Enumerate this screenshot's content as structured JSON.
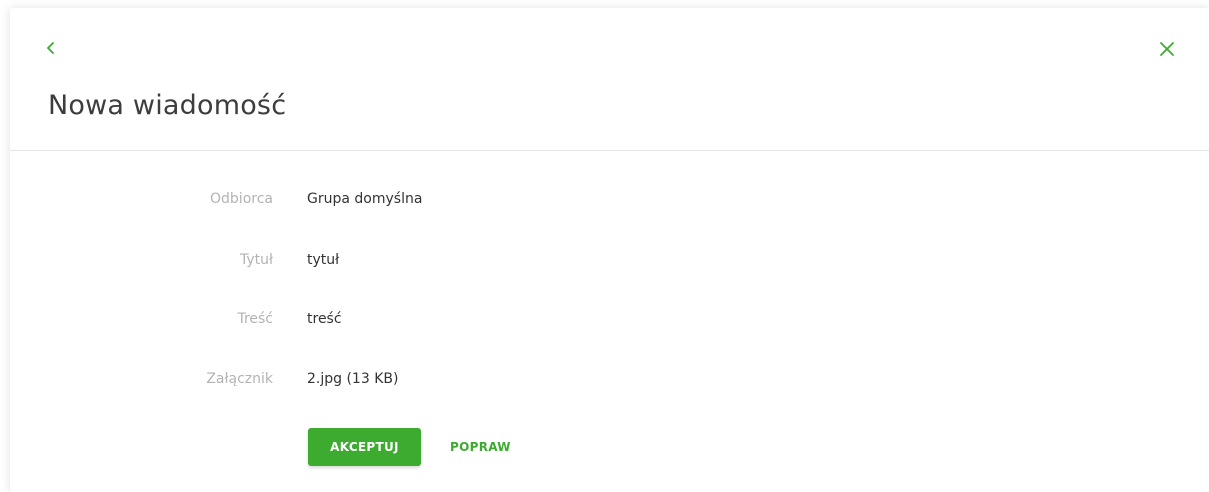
{
  "header": {
    "title": "Nowa wiadomość",
    "back_icon": "chevron-left-icon",
    "close_icon": "close-icon"
  },
  "form": {
    "rows": [
      {
        "label": "Odbiorca",
        "value": "Grupa domyślna"
      },
      {
        "label": "Tytuł",
        "value": "tytuł"
      },
      {
        "label": "Treść",
        "value": "treść"
      },
      {
        "label": "Załącznik",
        "value": "2.jpg (13 KB)"
      }
    ]
  },
  "actions": {
    "accept_label": "AKCEPTUJ",
    "fix_label": "POPRAW"
  },
  "colors": {
    "accent": "#3dab2f",
    "label": "#b3b3b3",
    "text": "#333333",
    "title": "#3d3d3d"
  }
}
